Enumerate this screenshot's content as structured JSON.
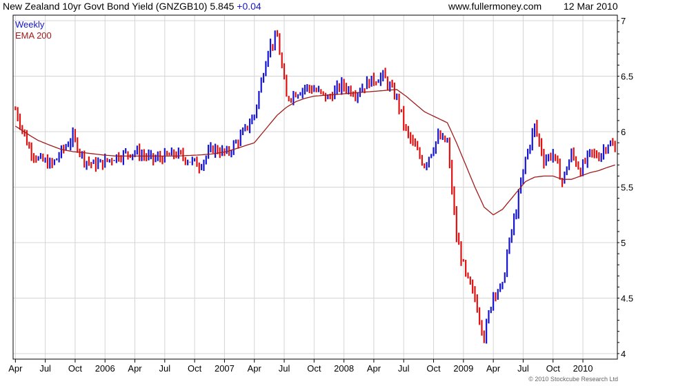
{
  "header": {
    "title": "New Zealand 10yr Govt Bond Yield (GNZGB10) 5.845",
    "change": "+0.04",
    "site": "www.fullermoney.com",
    "date": "12 Mar 2010"
  },
  "legend": {
    "period": "Weekly",
    "ema": "EMA 200"
  },
  "copyright": "© 2010 Stockcube Research Ltd",
  "colors": {
    "up": "#1414d2",
    "down": "#e01010",
    "ema": "#a11a1a",
    "grid": "#d4d4d4",
    "change": "#1414c8"
  },
  "chart_data": {
    "type": "line",
    "title": "New Zealand 10yr Govt Bond Yield (GNZGB10)",
    "ylim": [
      3.95,
      7.05
    ],
    "y_ticks": [
      4,
      4.5,
      5,
      5.5,
      6,
      6.5,
      7
    ],
    "y_tick_labels": [
      "4",
      "4.5",
      "5",
      "5.5",
      "6",
      "6.5",
      "7"
    ],
    "x_ticks": [
      0,
      13,
      26,
      39,
      52,
      65,
      78,
      91,
      104,
      117,
      130,
      143,
      156,
      169,
      182,
      195,
      208,
      221,
      234,
      247
    ],
    "x_tick_labels": [
      "Apr",
      "Jul",
      "Oct",
      "2006",
      "Apr",
      "Jul",
      "Oct",
      "2007",
      "Apr",
      "Jul",
      "Oct",
      "2008",
      "Apr",
      "Jul",
      "Oct",
      "2009",
      "Apr",
      "Jul",
      "Oct",
      "2010"
    ],
    "x_range": [
      -1,
      262
    ],
    "series": [
      {
        "name": "Weekly",
        "style": "weekly bars",
        "anchors_x": [
          0,
          6,
          10,
          16,
          20,
          25,
          30,
          34,
          38,
          44,
          52,
          60,
          70,
          80,
          86,
          92,
          98,
          104,
          110,
          114,
          118,
          122,
          126,
          130,
          136,
          142,
          148,
          154,
          160,
          166,
          170,
          174,
          178,
          184,
          188,
          192,
          196,
          200,
          204,
          208,
          212,
          214,
          218,
          222,
          226,
          230,
          234,
          238,
          242,
          246,
          250,
          254,
          258,
          261
        ],
        "anchors_y": [
          6.2,
          5.85,
          5.75,
          5.7,
          5.82,
          5.95,
          5.75,
          5.7,
          5.72,
          5.78,
          5.82,
          5.75,
          5.8,
          5.7,
          5.85,
          5.8,
          5.95,
          6.15,
          6.75,
          6.85,
          6.3,
          6.35,
          6.4,
          6.38,
          6.3,
          6.42,
          6.35,
          6.45,
          6.5,
          6.3,
          6.0,
          5.85,
          5.7,
          5.95,
          5.9,
          5.05,
          4.7,
          4.5,
          4.15,
          4.55,
          4.6,
          4.9,
          5.3,
          5.75,
          6.05,
          5.75,
          5.8,
          5.55,
          5.8,
          5.65,
          5.8,
          5.78,
          5.9,
          5.845
        ]
      },
      {
        "name": "EMA 200",
        "style": "line",
        "anchors_x": [
          0,
          6,
          10,
          16,
          20,
          25,
          30,
          34,
          38,
          44,
          52,
          60,
          70,
          80,
          86,
          92,
          98,
          104,
          110,
          114,
          118,
          122,
          126,
          130,
          136,
          142,
          148,
          154,
          160,
          166,
          170,
          174,
          178,
          184,
          188,
          192,
          196,
          200,
          204,
          208,
          212,
          214,
          218,
          222,
          226,
          230,
          234,
          238,
          242,
          246,
          250,
          254,
          258,
          261
        ],
        "anchors_y": [
          6.05,
          5.97,
          5.92,
          5.87,
          5.84,
          5.82,
          5.81,
          5.8,
          5.79,
          5.78,
          5.78,
          5.78,
          5.78,
          5.79,
          5.8,
          5.82,
          5.86,
          5.9,
          6.05,
          6.15,
          6.22,
          6.27,
          6.3,
          6.32,
          6.33,
          6.34,
          6.35,
          6.36,
          6.37,
          6.38,
          6.32,
          6.25,
          6.18,
          6.12,
          6.08,
          5.9,
          5.7,
          5.5,
          5.32,
          5.25,
          5.3,
          5.35,
          5.45,
          5.55,
          5.59,
          5.6,
          5.6,
          5.57,
          5.57,
          5.6,
          5.63,
          5.65,
          5.68,
          5.7
        ]
      }
    ]
  }
}
